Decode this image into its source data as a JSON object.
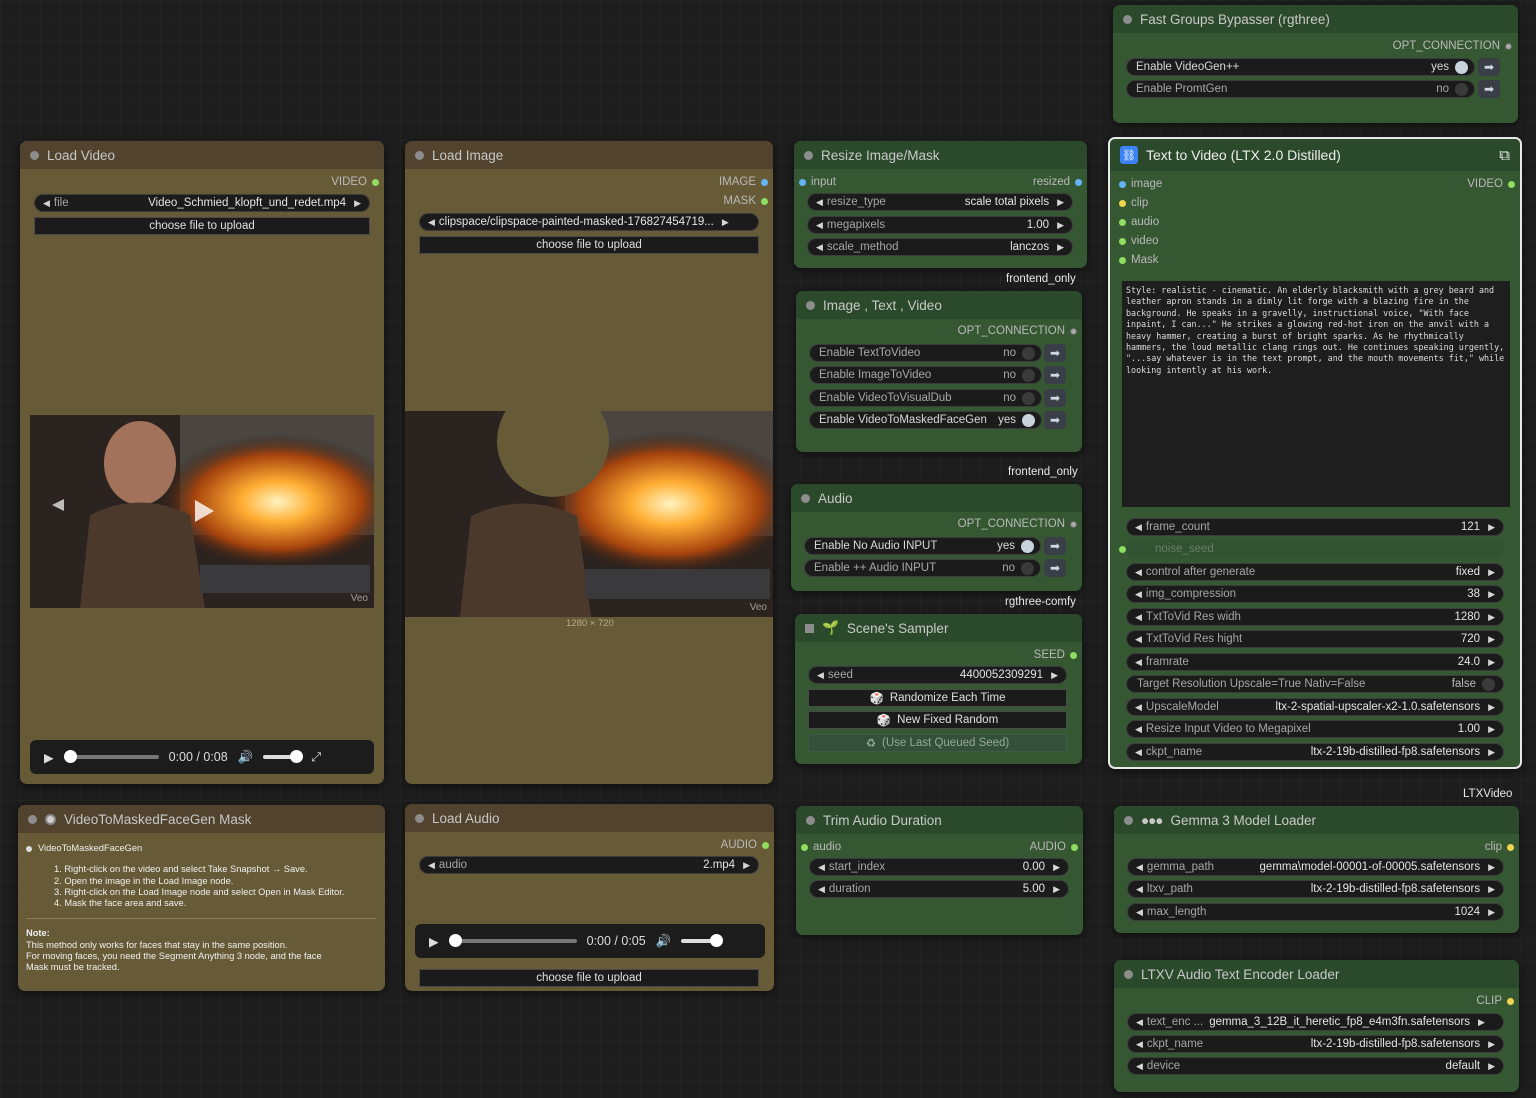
{
  "fast_groups": {
    "title": "Fast Groups Bypasser (rgthree)",
    "output": "OPT_CONNECTION",
    "toggles": [
      {
        "label": "Enable VideoGen++",
        "value": "yes"
      },
      {
        "label": "Enable PromtGen",
        "value": "no"
      }
    ]
  },
  "load_video": {
    "title": "Load Video",
    "output": "VIDEO",
    "file_label": "file",
    "file_value": "Video_Schmied_klopft_und_redet.mp4",
    "upload": "choose file to upload",
    "watermark": "Veo",
    "time": "0:00 / 0:08"
  },
  "load_image": {
    "title": "Load Image",
    "outputs": [
      "IMAGE",
      "MASK"
    ],
    "file_value": "clipspace/clipspace-painted-masked-176827454719...",
    "upload": "choose file to upload",
    "watermark": "Veo",
    "dims": "1280 × 720"
  },
  "resize": {
    "title": "Resize Image/Mask",
    "input": "input",
    "output": "resized",
    "widgets": [
      {
        "label": "resize_type",
        "value": "scale total pixels"
      },
      {
        "label": "megapixels",
        "value": "1.00"
      },
      {
        "label": "scale_method",
        "value": "lanczos"
      }
    ],
    "footer": "frontend_only"
  },
  "image_group": {
    "title": "Image  , Text  , Video",
    "output": "OPT_CONNECTION",
    "toggles": [
      {
        "label": "Enable TextToVideo",
        "value": "no"
      },
      {
        "label": "Enable ImageToVideo",
        "value": "no"
      },
      {
        "label": "Enable VideoToVisualDub",
        "value": "no"
      },
      {
        "label": "Enable VideoToMaskedFaceGen",
        "value": "yes"
      }
    ],
    "footer": "frontend_only"
  },
  "audio_group": {
    "title": "Audio",
    "output": "OPT_CONNECTION",
    "toggles": [
      {
        "label": "Enable No Audio INPUT",
        "value": "yes"
      },
      {
        "label": "Enable ++ Audio INPUT",
        "value": "no"
      }
    ],
    "footer": "rgthree-comfy"
  },
  "sampler": {
    "title": "Scene's Sampler",
    "output": "SEED",
    "seed_label": "seed",
    "seed_value": "4400052309291",
    "buttons": [
      "Randomize Each Time",
      "New Fixed Random",
      "(Use Last Queued Seed)"
    ]
  },
  "t2v": {
    "title": "Text to Video (LTX 2.0 Distilled)",
    "inputs": [
      "image",
      "clip",
      "audio",
      "video",
      "Mask"
    ],
    "output": "VIDEO",
    "prompt": "Style: realistic - cinematic. An elderly blacksmith with a grey beard and leather apron stands in a dimly lit forge with a blazing fire in the background. He speaks in a gravelly, instructional voice, \"With face inpaint, I can...\" He strikes a glowing red-hot iron on the anvil with a heavy hammer, creating a burst of bright sparks. As he rhythmically hammers, the loud metallic clang rings out. He continues speaking urgently, \"...say whatever is in the text prompt, and the mouth movements fit,\" while looking intently at his work.",
    "widgets": [
      {
        "label": "frame_count",
        "value": "121"
      },
      {
        "label": "noise_seed",
        "value": ""
      },
      {
        "label": "control after generate",
        "value": "fixed"
      },
      {
        "label": "img_compression",
        "value": "38"
      },
      {
        "label": "TxtToVid Res widh",
        "value": "1280"
      },
      {
        "label": "TxtToVid Res hight",
        "value": "720"
      },
      {
        "label": "framrate",
        "value": "24.0"
      },
      {
        "label": "Target Resolution    Upscale=True  Nativ=False",
        "value": "false"
      },
      {
        "label": "UpscaleModel",
        "value": "ltx-2-spatial-upscaler-x2-1.0.safetensors"
      },
      {
        "label": "Resize Input Video to Megapixel",
        "value": "1.00"
      },
      {
        "label": "ckpt_name",
        "value": "ltx-2-19b-distilled-fp8.safetensors"
      }
    ],
    "footer": "LTXVideo"
  },
  "mask_note": {
    "title": "VideoToMaskedFaceGen Mask",
    "heading": "VideoToMaskedFaceGen",
    "steps": [
      "1. Right-click on the video and select Take Snapshot → Save.",
      "2. Open the image in the Load Image node.",
      "3. Right-click on the Load Image node and select Open in Mask Editor.",
      "4. Mask the face area and save."
    ],
    "note_label": "Note:",
    "note_lines": [
      "This method only works for faces that stay in the same position.",
      "For moving faces, you need the Segment Anything 3 node, and the face",
      "Mask must be tracked."
    ]
  },
  "load_audio": {
    "title": "Load Audio",
    "output": "AUDIO",
    "audio_label": "audio",
    "audio_value": "2.mp4",
    "time": "0:00 / 0:05",
    "upload": "choose file to upload"
  },
  "trim": {
    "title": "Trim Audio Duration",
    "input": "audio",
    "output": "AUDIO",
    "widgets": [
      {
        "label": "start_index",
        "value": "0.00"
      },
      {
        "label": "duration",
        "value": "5.00"
      }
    ]
  },
  "gemma": {
    "title": "Gemma 3 Model Loader",
    "output": "clip",
    "widgets": [
      {
        "label": "gemma_path",
        "value": "gemma\\model-00001-of-00005.safetensors"
      },
      {
        "label": "ltxv_path",
        "value": "ltx-2-19b-distilled-fp8.safetensors"
      },
      {
        "label": "max_length",
        "value": "1024"
      }
    ]
  },
  "ltxv_audio": {
    "title": "LTXV Audio Text Encoder Loader",
    "output": "CLIP",
    "widgets": [
      {
        "label": "text_enc ...",
        "value": "gemma_3_12B_it_heretic_fp8_e4m3fn.safetensors"
      },
      {
        "label": "ckpt_name",
        "value": "ltx-2-19b-distilled-fp8.safetensors"
      },
      {
        "label": "device",
        "value": "default"
      }
    ]
  }
}
